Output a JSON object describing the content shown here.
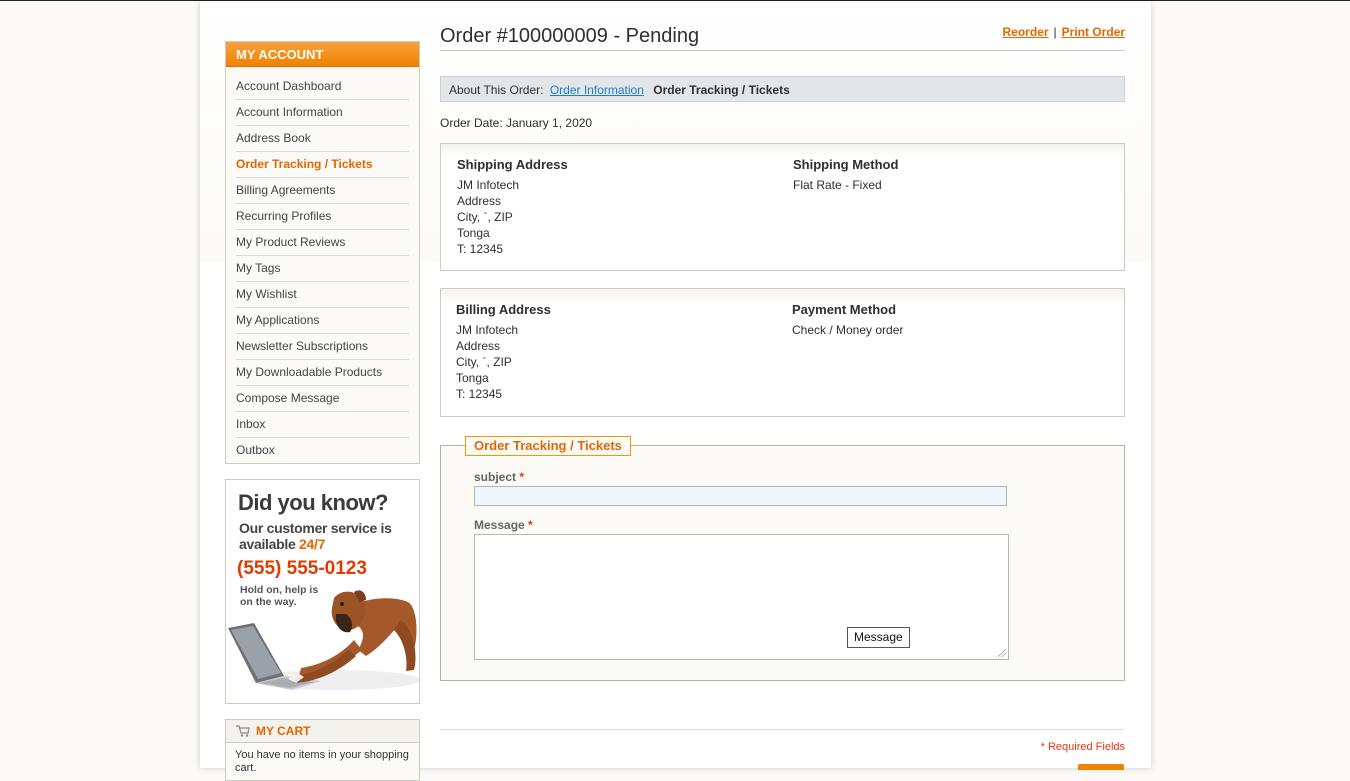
{
  "sidebar": {
    "title": "My Account",
    "items": [
      {
        "label": "Account Dashboard"
      },
      {
        "label": "Account Information"
      },
      {
        "label": "Address Book"
      },
      {
        "label": "Order Tracking / Tickets"
      },
      {
        "label": "Billing Agreements"
      },
      {
        "label": "Recurring Profiles"
      },
      {
        "label": "My Product Reviews"
      },
      {
        "label": "My Tags"
      },
      {
        "label": "My Wishlist"
      },
      {
        "label": "My Applications"
      },
      {
        "label": "Newsletter Subscriptions"
      },
      {
        "label": "My Downloadable Products"
      },
      {
        "label": "Compose Message"
      },
      {
        "label": "Inbox"
      },
      {
        "label": "Outbox"
      }
    ],
    "current_index": 3
  },
  "promo": {
    "title": "Did you know?",
    "line1": "Our customer service is",
    "line2_prefix": "available ",
    "line2_highlight": "24/7",
    "phone": "(555) 555-0123",
    "hold1": "Hold on, help is",
    "hold2": "on the way."
  },
  "cart": {
    "title": "My Cart",
    "empty_text": "You have no items in your shopping cart."
  },
  "order": {
    "title": "Order #100000009 - Pending",
    "reorder_label": "Reorder",
    "separator": "|",
    "print_label": "Print Order",
    "about_label": "About This Order:",
    "tab_info": "Order Information",
    "tab_tracking": "Order Tracking / Tickets",
    "date_text": "Order Date: January 1, 2020"
  },
  "shipping": {
    "address_title": "Shipping Address",
    "address_lines": [
      "JM Infotech",
      "Address",
      "City, `, ZIP",
      "Tonga",
      "T: 12345"
    ],
    "method_title": "Shipping Method",
    "method_value": "Flat Rate - Fixed"
  },
  "billing": {
    "address_title": "Billing Address",
    "address_lines": [
      "JM Infotech",
      "Address",
      "City, `, ZIP",
      "Tonga",
      "T: 12345"
    ],
    "method_title": "Payment Method",
    "method_value": "Check / Money order"
  },
  "ticket_form": {
    "legend": "Order Tracking / Tickets",
    "subject_label": "subject",
    "message_label": "Message",
    "required_mark": "*",
    "subject_value": "",
    "message_value": "",
    "tooltip": "Message",
    "required_note": "* Required Fields"
  },
  "colors": {
    "accent": "#e26703",
    "header_orange": "#f18200",
    "link_blue": "#1e7ec8",
    "required_red": "#eb340a"
  }
}
